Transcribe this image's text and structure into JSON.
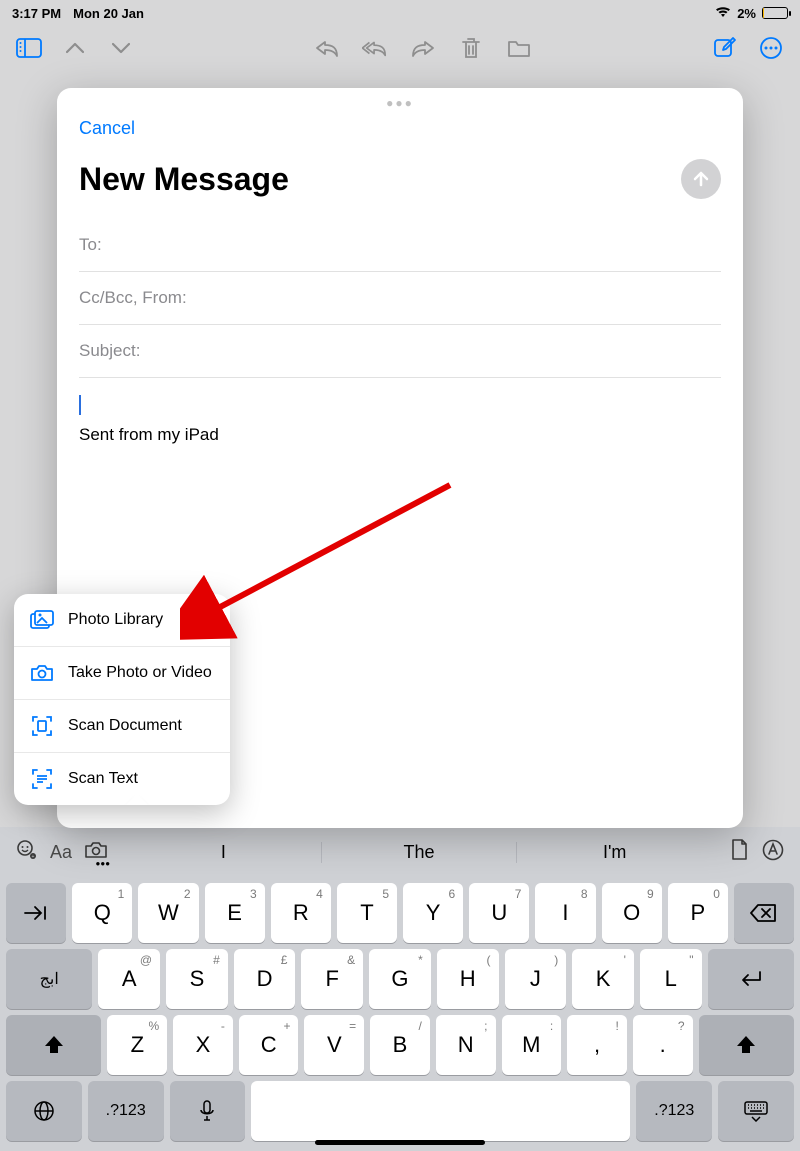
{
  "status": {
    "time": "3:17 PM",
    "date": "Mon 20 Jan",
    "battery_pct": "2%"
  },
  "toolbar": {},
  "modal": {
    "cancel": "Cancel",
    "title": "New Message",
    "to_label": "To:",
    "cc_label": "Cc/Bcc, From:",
    "subject_label": "Subject:",
    "signature": "Sent from my iPad"
  },
  "popover": {
    "items": [
      "Photo Library",
      "Take Photo or Video",
      "Scan Document",
      "Scan Text"
    ]
  },
  "suggestions": [
    "I",
    "The",
    "I'm"
  ],
  "keyboard": {
    "row1": [
      {
        "main": "Q",
        "sub": "1"
      },
      {
        "main": "W",
        "sub": "2"
      },
      {
        "main": "E",
        "sub": "3"
      },
      {
        "main": "R",
        "sub": "4"
      },
      {
        "main": "T",
        "sub": "5"
      },
      {
        "main": "Y",
        "sub": "6"
      },
      {
        "main": "U",
        "sub": "7"
      },
      {
        "main": "I",
        "sub": "8"
      },
      {
        "main": "O",
        "sub": "9"
      },
      {
        "main": "P",
        "sub": "0"
      }
    ],
    "row2": [
      {
        "main": "A",
        "sub": "@"
      },
      {
        "main": "S",
        "sub": "#"
      },
      {
        "main": "D",
        "sub": "£"
      },
      {
        "main": "F",
        "sub": "&"
      },
      {
        "main": "G",
        "sub": "*"
      },
      {
        "main": "H",
        "sub": "("
      },
      {
        "main": "J",
        "sub": ")"
      },
      {
        "main": "K",
        "sub": "'"
      },
      {
        "main": "L",
        "sub": "\""
      }
    ],
    "row3": [
      {
        "main": "Z",
        "sub": "%"
      },
      {
        "main": "X",
        "sub": "-"
      },
      {
        "main": "C",
        "sub": "+"
      },
      {
        "main": "V",
        "sub": "="
      },
      {
        "main": "B",
        "sub": "/"
      },
      {
        "main": "N",
        "sub": ";"
      },
      {
        "main": "M",
        "sub": ":"
      },
      {
        "main": ",",
        "sub": "!"
      },
      {
        "main": ".",
        "sub": "?"
      }
    ],
    "sym": ".?123",
    "lang_key": "ابج"
  }
}
